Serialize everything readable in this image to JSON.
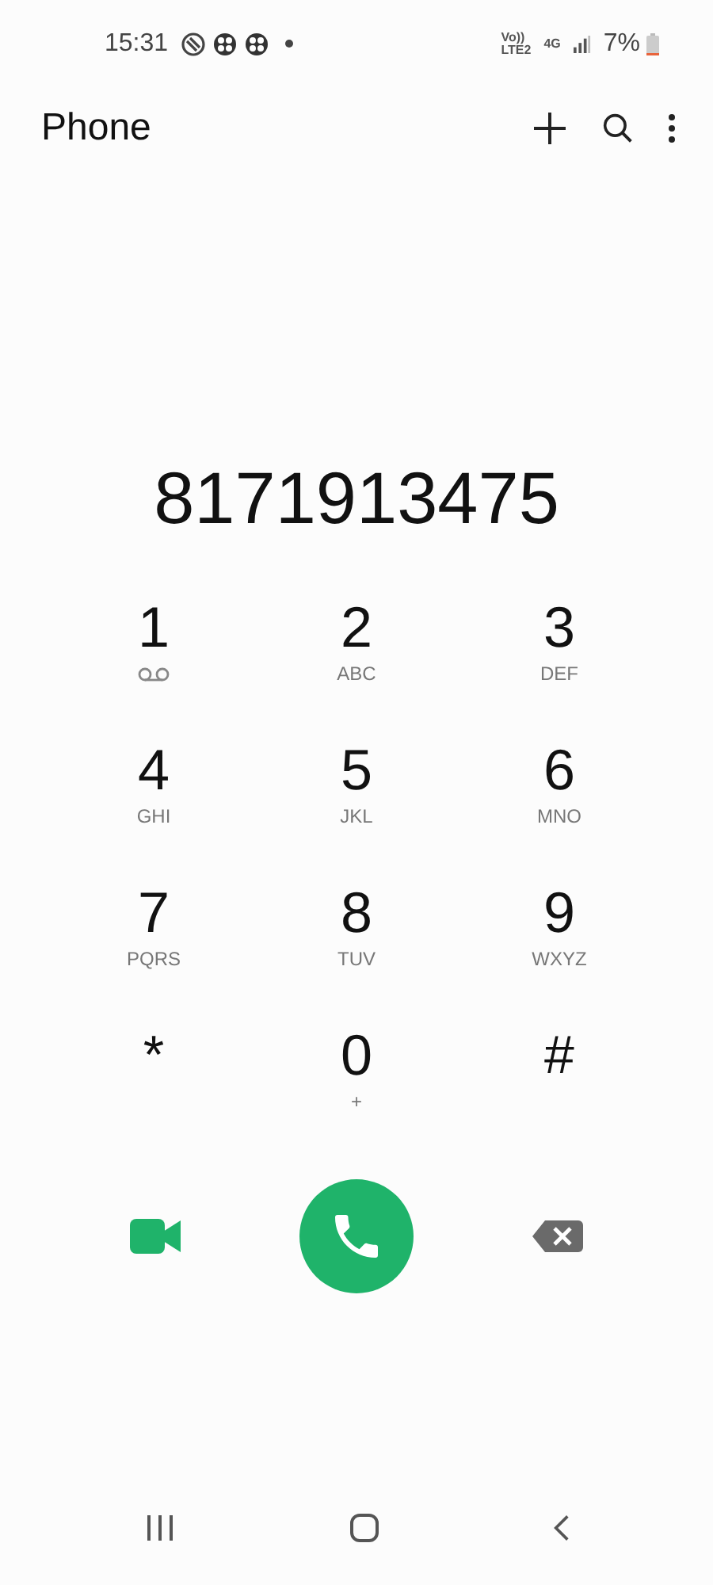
{
  "status_bar": {
    "time": "15:31",
    "network_top": "Vo))",
    "network_bottom": "LTE2",
    "data_type": "4G",
    "battery": "7%"
  },
  "header": {
    "title": "Phone"
  },
  "dialed_number": "8171913475",
  "keypad": [
    {
      "digit": "1",
      "kind": "voicemail"
    },
    {
      "digit": "2",
      "kind": "letters",
      "letters": "ABC"
    },
    {
      "digit": "3",
      "kind": "letters",
      "letters": "DEF"
    },
    {
      "digit": "4",
      "kind": "letters",
      "letters": "GHI"
    },
    {
      "digit": "5",
      "kind": "letters",
      "letters": "JKL"
    },
    {
      "digit": "6",
      "kind": "letters",
      "letters": "MNO"
    },
    {
      "digit": "7",
      "kind": "letters",
      "letters": "PQRS"
    },
    {
      "digit": "8",
      "kind": "letters",
      "letters": "TUV"
    },
    {
      "digit": "9",
      "kind": "letters",
      "letters": "WXYZ"
    },
    {
      "digit": "*",
      "kind": "symbol"
    },
    {
      "digit": "0",
      "kind": "letters",
      "letters": "+"
    },
    {
      "digit": "#",
      "kind": "symbol"
    }
  ]
}
